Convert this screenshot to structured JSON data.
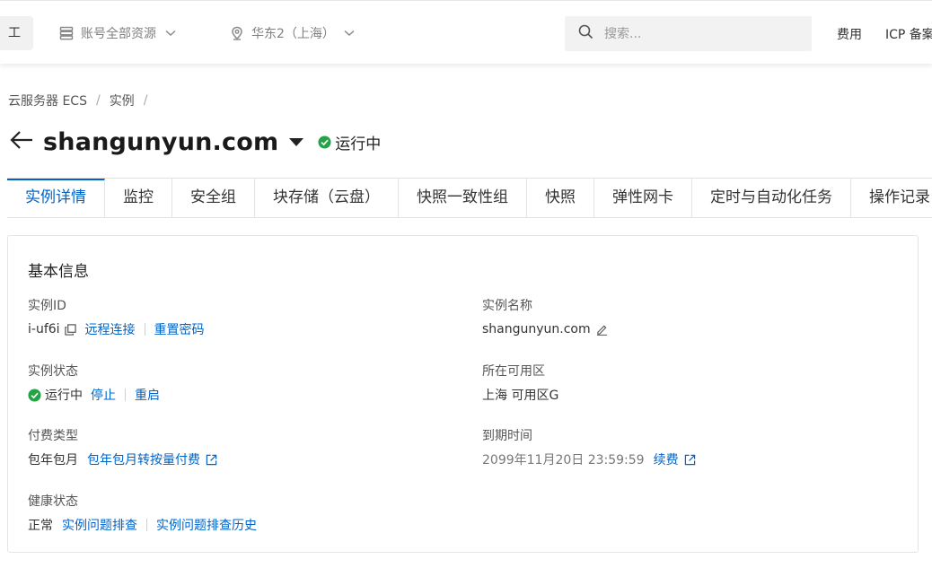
{
  "topbar": {
    "workbench_label": "工作台",
    "resources_label": "账号全部资源",
    "region_label": "华东2（上海）",
    "search_placeholder": "搜索...",
    "fee_label": "费用",
    "icp_label": "ICP 备案"
  },
  "breadcrumb": {
    "items": [
      "云服务器 ECS",
      "实例"
    ],
    "separator": "/"
  },
  "header": {
    "title": "shangunyun.com",
    "status": "运行中"
  },
  "tabs": [
    {
      "label": "实例详情",
      "active": true
    },
    {
      "label": "监控"
    },
    {
      "label": "安全组"
    },
    {
      "label": "块存储（云盘）"
    },
    {
      "label": "快照一致性组"
    },
    {
      "label": "快照"
    },
    {
      "label": "弹性网卡"
    },
    {
      "label": "定时与自动化任务"
    },
    {
      "label": "操作记录"
    }
  ],
  "basic_info": {
    "title": "基本信息",
    "instance_id": {
      "label": "实例ID",
      "value": "i-uf6i",
      "remote_connect": "远程连接",
      "reset_password": "重置密码"
    },
    "instance_name": {
      "label": "实例名称",
      "value": "shangunyun.com"
    },
    "instance_status": {
      "label": "实例状态",
      "value": "运行中",
      "stop": "停止",
      "restart": "重启"
    },
    "zone": {
      "label": "所在可用区",
      "value": "上海 可用区G"
    },
    "billing_type": {
      "label": "付费类型",
      "value": "包年包月",
      "convert": "包年包月转按量付费"
    },
    "expire_time": {
      "label": "到期时间",
      "value": "2099年11月20日 23:59:59",
      "renew": "续费"
    },
    "health": {
      "label": "健康状态",
      "value": "正常",
      "troubleshoot": "实例问题排查",
      "troubleshoot_history": "实例问题排查历史"
    }
  },
  "colors": {
    "accent": "#0064c8",
    "status_green": "#23a345"
  }
}
